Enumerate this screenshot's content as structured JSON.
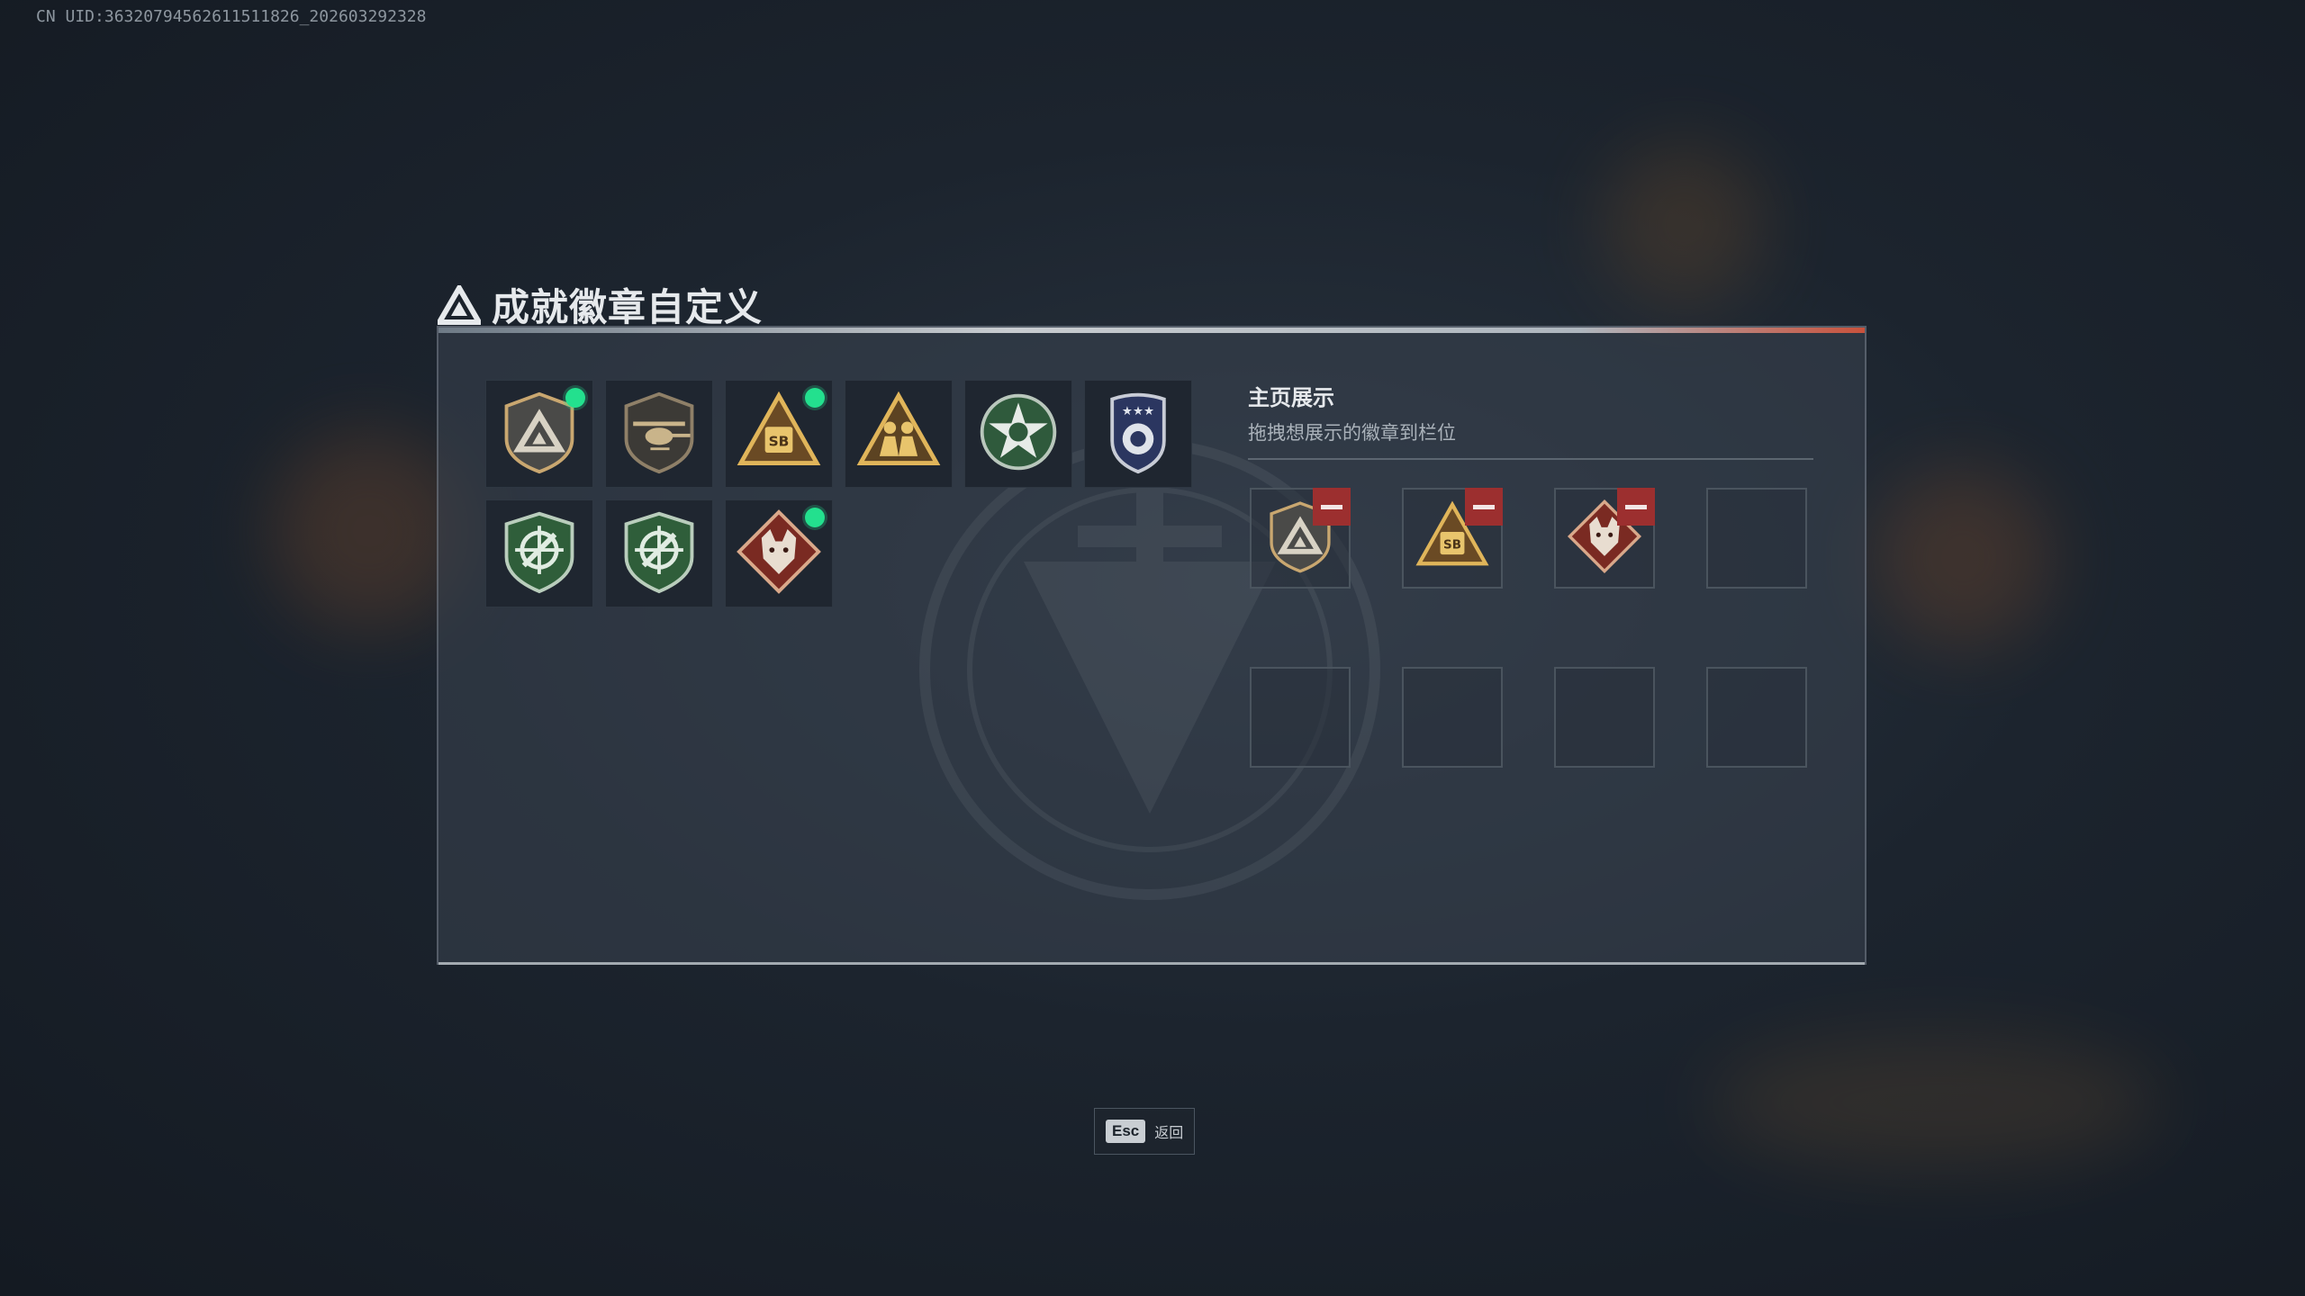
{
  "uid_text": "CN UID:3632079456261151182​6_202603292328",
  "title": "成就徽章自定义",
  "title_small": "",
  "badges": [
    {
      "name": "triangle-shield-badge",
      "icon": "triangle-shield",
      "selected": true
    },
    {
      "name": "helicopter-badge",
      "icon": "helicopter",
      "selected": false
    },
    {
      "name": "sb-train-badge",
      "icon": "sb-triangle",
      "selected": true
    },
    {
      "name": "soldier-triangle-badge",
      "icon": "soldier",
      "selected": false
    },
    {
      "name": "green-star-badge",
      "icon": "green-star",
      "selected": false
    },
    {
      "name": "blue-police-badge",
      "icon": "blue-police",
      "selected": false
    },
    {
      "name": "green-crosshair-badge-1",
      "icon": "green-crosshair",
      "selected": false
    },
    {
      "name": "green-crosshair-badge-2",
      "icon": "green-crosshair",
      "selected": false
    },
    {
      "name": "wolf-diamond-badge",
      "icon": "wolf",
      "selected": true
    }
  ],
  "showcase": {
    "title": "主页展示",
    "subtitle": "拖拽想展示的徽章到栏位",
    "slots": [
      "triangle-shield",
      "sb-triangle",
      "wolf",
      "",
      "",
      "",
      "",
      ""
    ]
  },
  "footer": {
    "key": "Esc",
    "label": "返回"
  },
  "colors": {
    "selected_dot": "#23e08e",
    "remove_button": "#9c2f2f"
  }
}
